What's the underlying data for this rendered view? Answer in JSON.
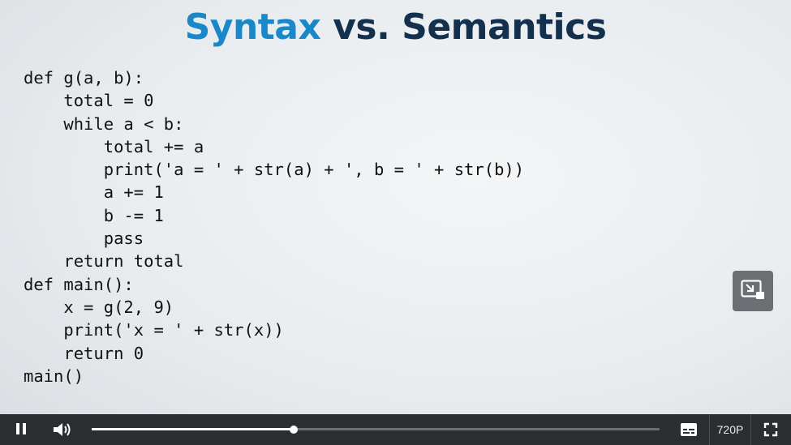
{
  "slide": {
    "title_part1": "Syntax",
    "title_part2": "vs. Semantics",
    "title_colors": {
      "part1": "#1a87c8",
      "part2": "#13314f"
    },
    "code_lines": [
      "def g(a, b):",
      "    total = 0",
      "    while a < b:",
      "        total += a",
      "        print('a = ' + str(a) + ', b = ' + str(b))",
      "        a += 1",
      "        b -= 1",
      "        pass",
      "    return total",
      "def main():",
      "    x = g(2, 9)",
      "    print('x = ' + str(x))",
      "    return 0",
      "main()"
    ]
  },
  "overlay": {
    "pip_icon": "picture-in-picture-exit-icon"
  },
  "player": {
    "play_state_icon": "pause-icon",
    "volume_icon": "volume-icon",
    "progress_fraction": 0.356,
    "captions_icon": "closed-captions-icon",
    "quality_label": "720P",
    "fullscreen_icon": "fullscreen-icon"
  }
}
